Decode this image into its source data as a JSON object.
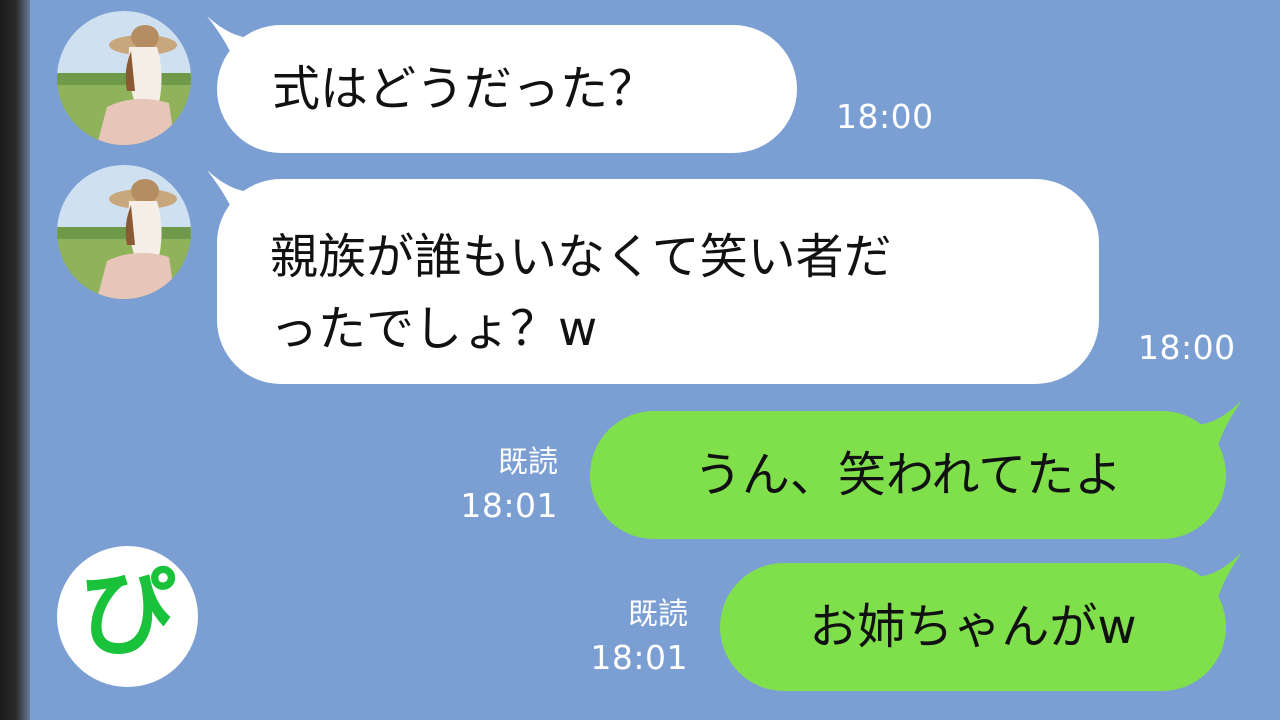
{
  "messages": {
    "m1": {
      "text": "式はどうだった？",
      "time": "18:00"
    },
    "m2": {
      "line1": "親族が誰もいなくて笑い者だ",
      "line2": "ったでしょ？w",
      "time": "18:00"
    },
    "m3": {
      "text": "うん、笑われてたよ",
      "read": "既読",
      "time": "18:01"
    },
    "m4": {
      "text": "お姉ちゃんがw",
      "read": "既読",
      "time": "18:01"
    }
  },
  "logo": {
    "text": "ぴ"
  },
  "colors": {
    "background": "#7b9fd3",
    "incoming_bubble": "#ffffff",
    "outgoing_bubble": "#80e04c",
    "logo_text": "#19c23a"
  },
  "icons": [
    "contact-avatar-photo",
    "brand-logo-pi"
  ]
}
